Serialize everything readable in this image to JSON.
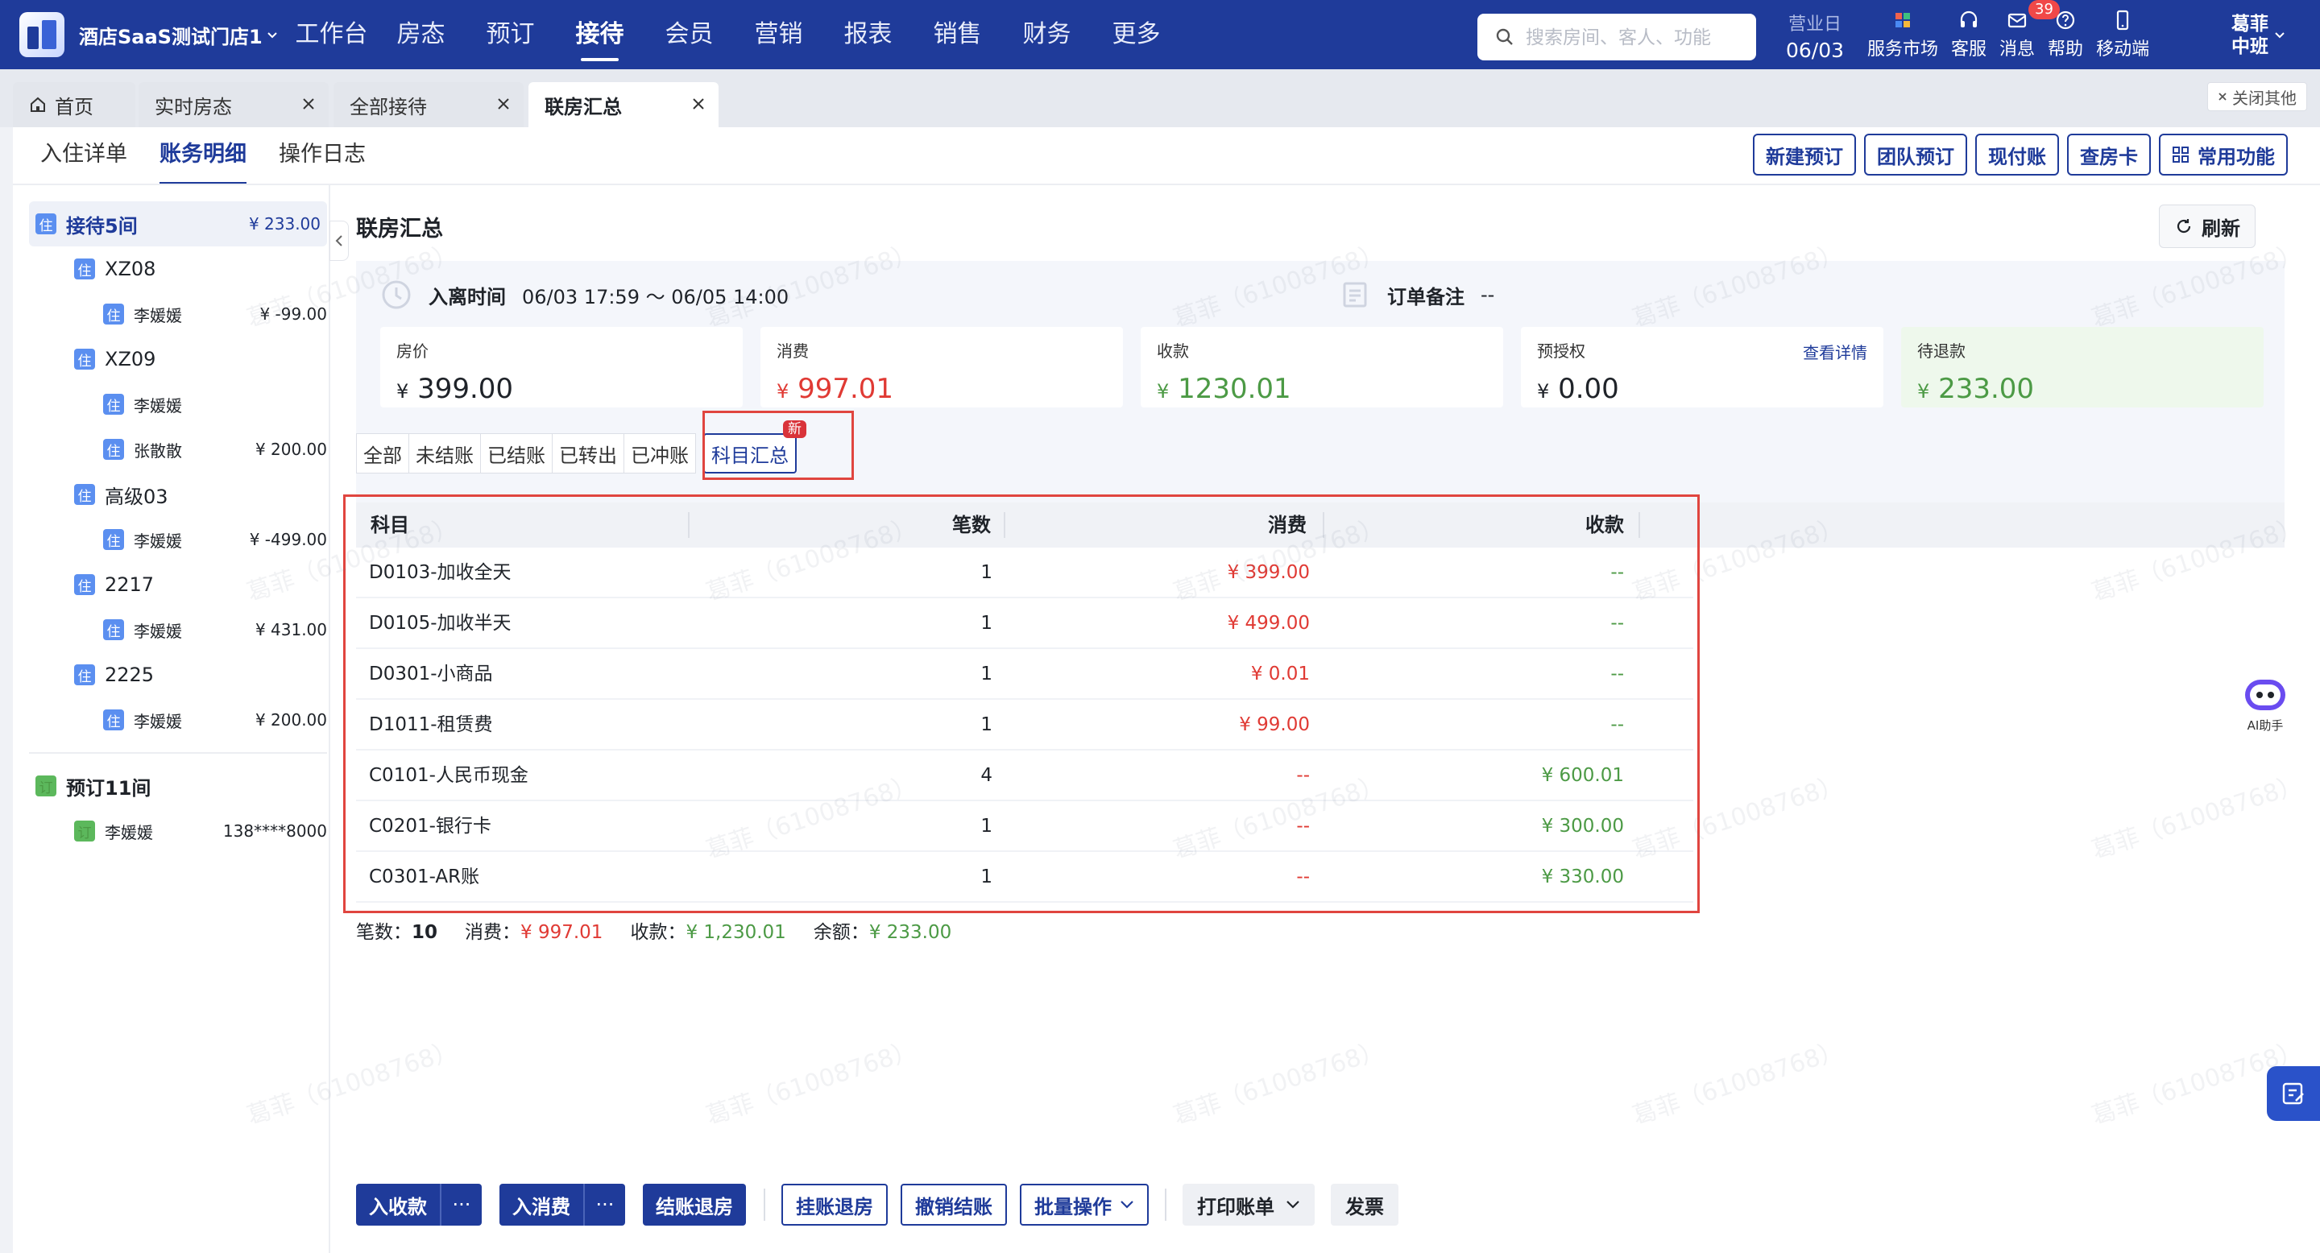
{
  "topnav": {
    "store_name": "酒店SaaS测试门店1",
    "menu": [
      "工作台",
      "房态",
      "预订",
      "接待",
      "会员",
      "营销",
      "报表",
      "销售",
      "财务",
      "更多"
    ],
    "active_menu": "接待",
    "search_placeholder": "搜索房间、客人、功能",
    "biz_date_label": "营业日",
    "biz_date": "06/03",
    "tools": [
      {
        "label": "服务市场",
        "icon": "grid-apps-icon"
      },
      {
        "label": "客服",
        "icon": "headset-icon"
      },
      {
        "label": "消息",
        "icon": "mail-icon",
        "badge": "39"
      },
      {
        "label": "帮助",
        "icon": "help-circle-icon"
      },
      {
        "label": "移动端",
        "icon": "mobile-icon"
      }
    ],
    "user_name": "葛菲",
    "user_shift": "中班"
  },
  "page_tabs": {
    "items": [
      "首页",
      "实时房态",
      "全部接待",
      "联房汇总"
    ],
    "active": "联房汇总",
    "close_others": "关闭其他"
  },
  "subtabs": {
    "items": [
      "入住详单",
      "账务明细",
      "操作日志"
    ],
    "active": "账务明细"
  },
  "actions": [
    "新建预订",
    "团队预订",
    "现付账",
    "查房卡",
    "常用功能"
  ],
  "tree": {
    "checkin_group": {
      "label": "接待5间",
      "amount": "¥ 233.00"
    },
    "rooms": [
      {
        "room": "XZ08",
        "guests": [
          {
            "name": "李媛媛",
            "amount": "¥ -99.00"
          }
        ]
      },
      {
        "room": "XZ09",
        "guests": [
          {
            "name": "李媛媛",
            "amount": ""
          },
          {
            "name": "张散散",
            "amount": "¥ 200.00"
          }
        ]
      },
      {
        "room": "高级03",
        "guests": [
          {
            "name": "李媛媛",
            "amount": "¥ -499.00"
          }
        ]
      },
      {
        "room": "2217",
        "guests": [
          {
            "name": "李媛媛",
            "amount": "¥ 431.00"
          }
        ]
      },
      {
        "room": "2225",
        "guests": [
          {
            "name": "李媛媛",
            "amount": "¥ 200.00"
          }
        ]
      }
    ],
    "tag_checkin": "住",
    "tag_booking": "订",
    "booking_group": {
      "label": "预订11间"
    },
    "booking_guest": {
      "name": "李媛媛",
      "phone": "138****8000"
    }
  },
  "main": {
    "title": "联房汇总",
    "refresh": "刷新",
    "stay_label": "入离时间",
    "stay_value": "06/03 17:59 ～ 06/05 14:00",
    "remark_label": "订单备注",
    "remark_value": "--",
    "stats": [
      {
        "label": "房价",
        "currency": "¥",
        "value": "399.00",
        "color": "#1f2329"
      },
      {
        "label": "消费",
        "currency": "¥",
        "value": "997.01",
        "color": "#e03a34"
      },
      {
        "label": "收款",
        "currency": "¥",
        "value": "1230.01",
        "color": "#4c9a45"
      },
      {
        "label": "预授权",
        "currency": "¥",
        "value": "0.00",
        "color": "#1f2329",
        "link": "查看详情"
      },
      {
        "label": "待退款",
        "currency": "¥",
        "value": "233.00",
        "color": "#4c9a45"
      }
    ],
    "filters": [
      "全部",
      "未结账",
      "已结账",
      "已转出",
      "已冲账",
      "科目汇总"
    ],
    "active_filter": "科目汇总",
    "new_badge": "新"
  },
  "table": {
    "headers": {
      "subject": "科目",
      "count": "笔数",
      "consume": "消费",
      "receipt": "收款"
    },
    "rows": [
      {
        "subject": "D0103-加收全天",
        "count": "1",
        "consume": "¥ 399.00",
        "receipt": "--"
      },
      {
        "subject": "D0105-加收半天",
        "count": "1",
        "consume": "¥ 499.00",
        "receipt": "--"
      },
      {
        "subject": "D0301-小商品",
        "count": "1",
        "consume": "¥ 0.01",
        "receipt": "--"
      },
      {
        "subject": "D1011-租赁费",
        "count": "1",
        "consume": "¥ 99.00",
        "receipt": "--"
      },
      {
        "subject": "C0101-人民币现金",
        "count": "4",
        "consume": "--",
        "receipt": "¥ 600.01"
      },
      {
        "subject": "C0201-银行卡",
        "count": "1",
        "consume": "--",
        "receipt": "¥ 300.00"
      },
      {
        "subject": "C0301-AR账",
        "count": "1",
        "consume": "--",
        "receipt": "¥ 330.00"
      }
    ],
    "summary": {
      "count_label": "笔数：",
      "count": "10",
      "consume_label": "消费：",
      "consume": "¥ 997.01",
      "receipt_label": "收款：",
      "receipt": "¥ 1,230.01",
      "balance_label": "余额：",
      "balance": "¥ 233.00"
    }
  },
  "bottom": {
    "receipt_in": "入收款",
    "consume_in": "入消费",
    "more": "···",
    "checkout": "结账退房",
    "hang_checkout": "挂账退房",
    "cancel_settle": "撤销结账",
    "batch": "批量操作",
    "print": "打印账单",
    "invoice": "发票"
  },
  "ai_label": "AI助手",
  "watermark": "葛菲（61008768）",
  "colors": {
    "brand": "#1f3b9a",
    "consume": "#e03a34",
    "receipt": "#4c9a45",
    "highlight": "#e0453f"
  }
}
